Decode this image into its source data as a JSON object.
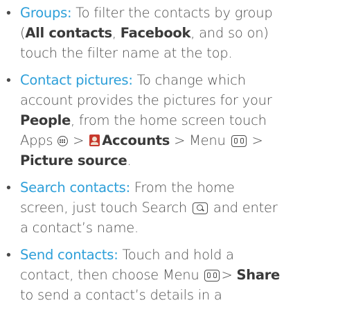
{
  "bullet": "•",
  "colors": {
    "term": "#2d9fd9",
    "body_text": "#4b4b4b"
  },
  "tips": [
    {
      "term": "Groups:",
      "lines": [
        [
          " To filter the contacts by group"
        ],
        [
          "(",
          "All contacts",
          ", ",
          "Facebook",
          ", and so on)"
        ],
        [
          "touch the filter name at the top."
        ]
      ]
    },
    {
      "term": "Contact pictures:",
      "lines": [
        [
          " To change which"
        ],
        [
          "account provides the pictures for your"
        ],
        [
          "People",
          ", from the home screen touch"
        ],
        [
          "Apps",
          " > ",
          "Accounts",
          " > Menu",
          " >"
        ],
        [
          "Picture source",
          "."
        ]
      ]
    },
    {
      "term": "Search contacts:",
      "lines": [
        [
          " From the home"
        ],
        [
          "screen, just touch Search",
          " and enter"
        ],
        [
          "a contact’s name."
        ]
      ]
    },
    {
      "term": "Send contacts:",
      "lines": [
        [
          " Touch and hold a"
        ],
        [
          "contact, then choose Menu ",
          "> ",
          "Share"
        ],
        [
          "to send a contact’s details in a"
        ]
      ]
    }
  ],
  "icons": {
    "apps": "apps-icon",
    "accounts": "accounts-icon",
    "menu": "menu-icon",
    "search": "search-icon"
  }
}
